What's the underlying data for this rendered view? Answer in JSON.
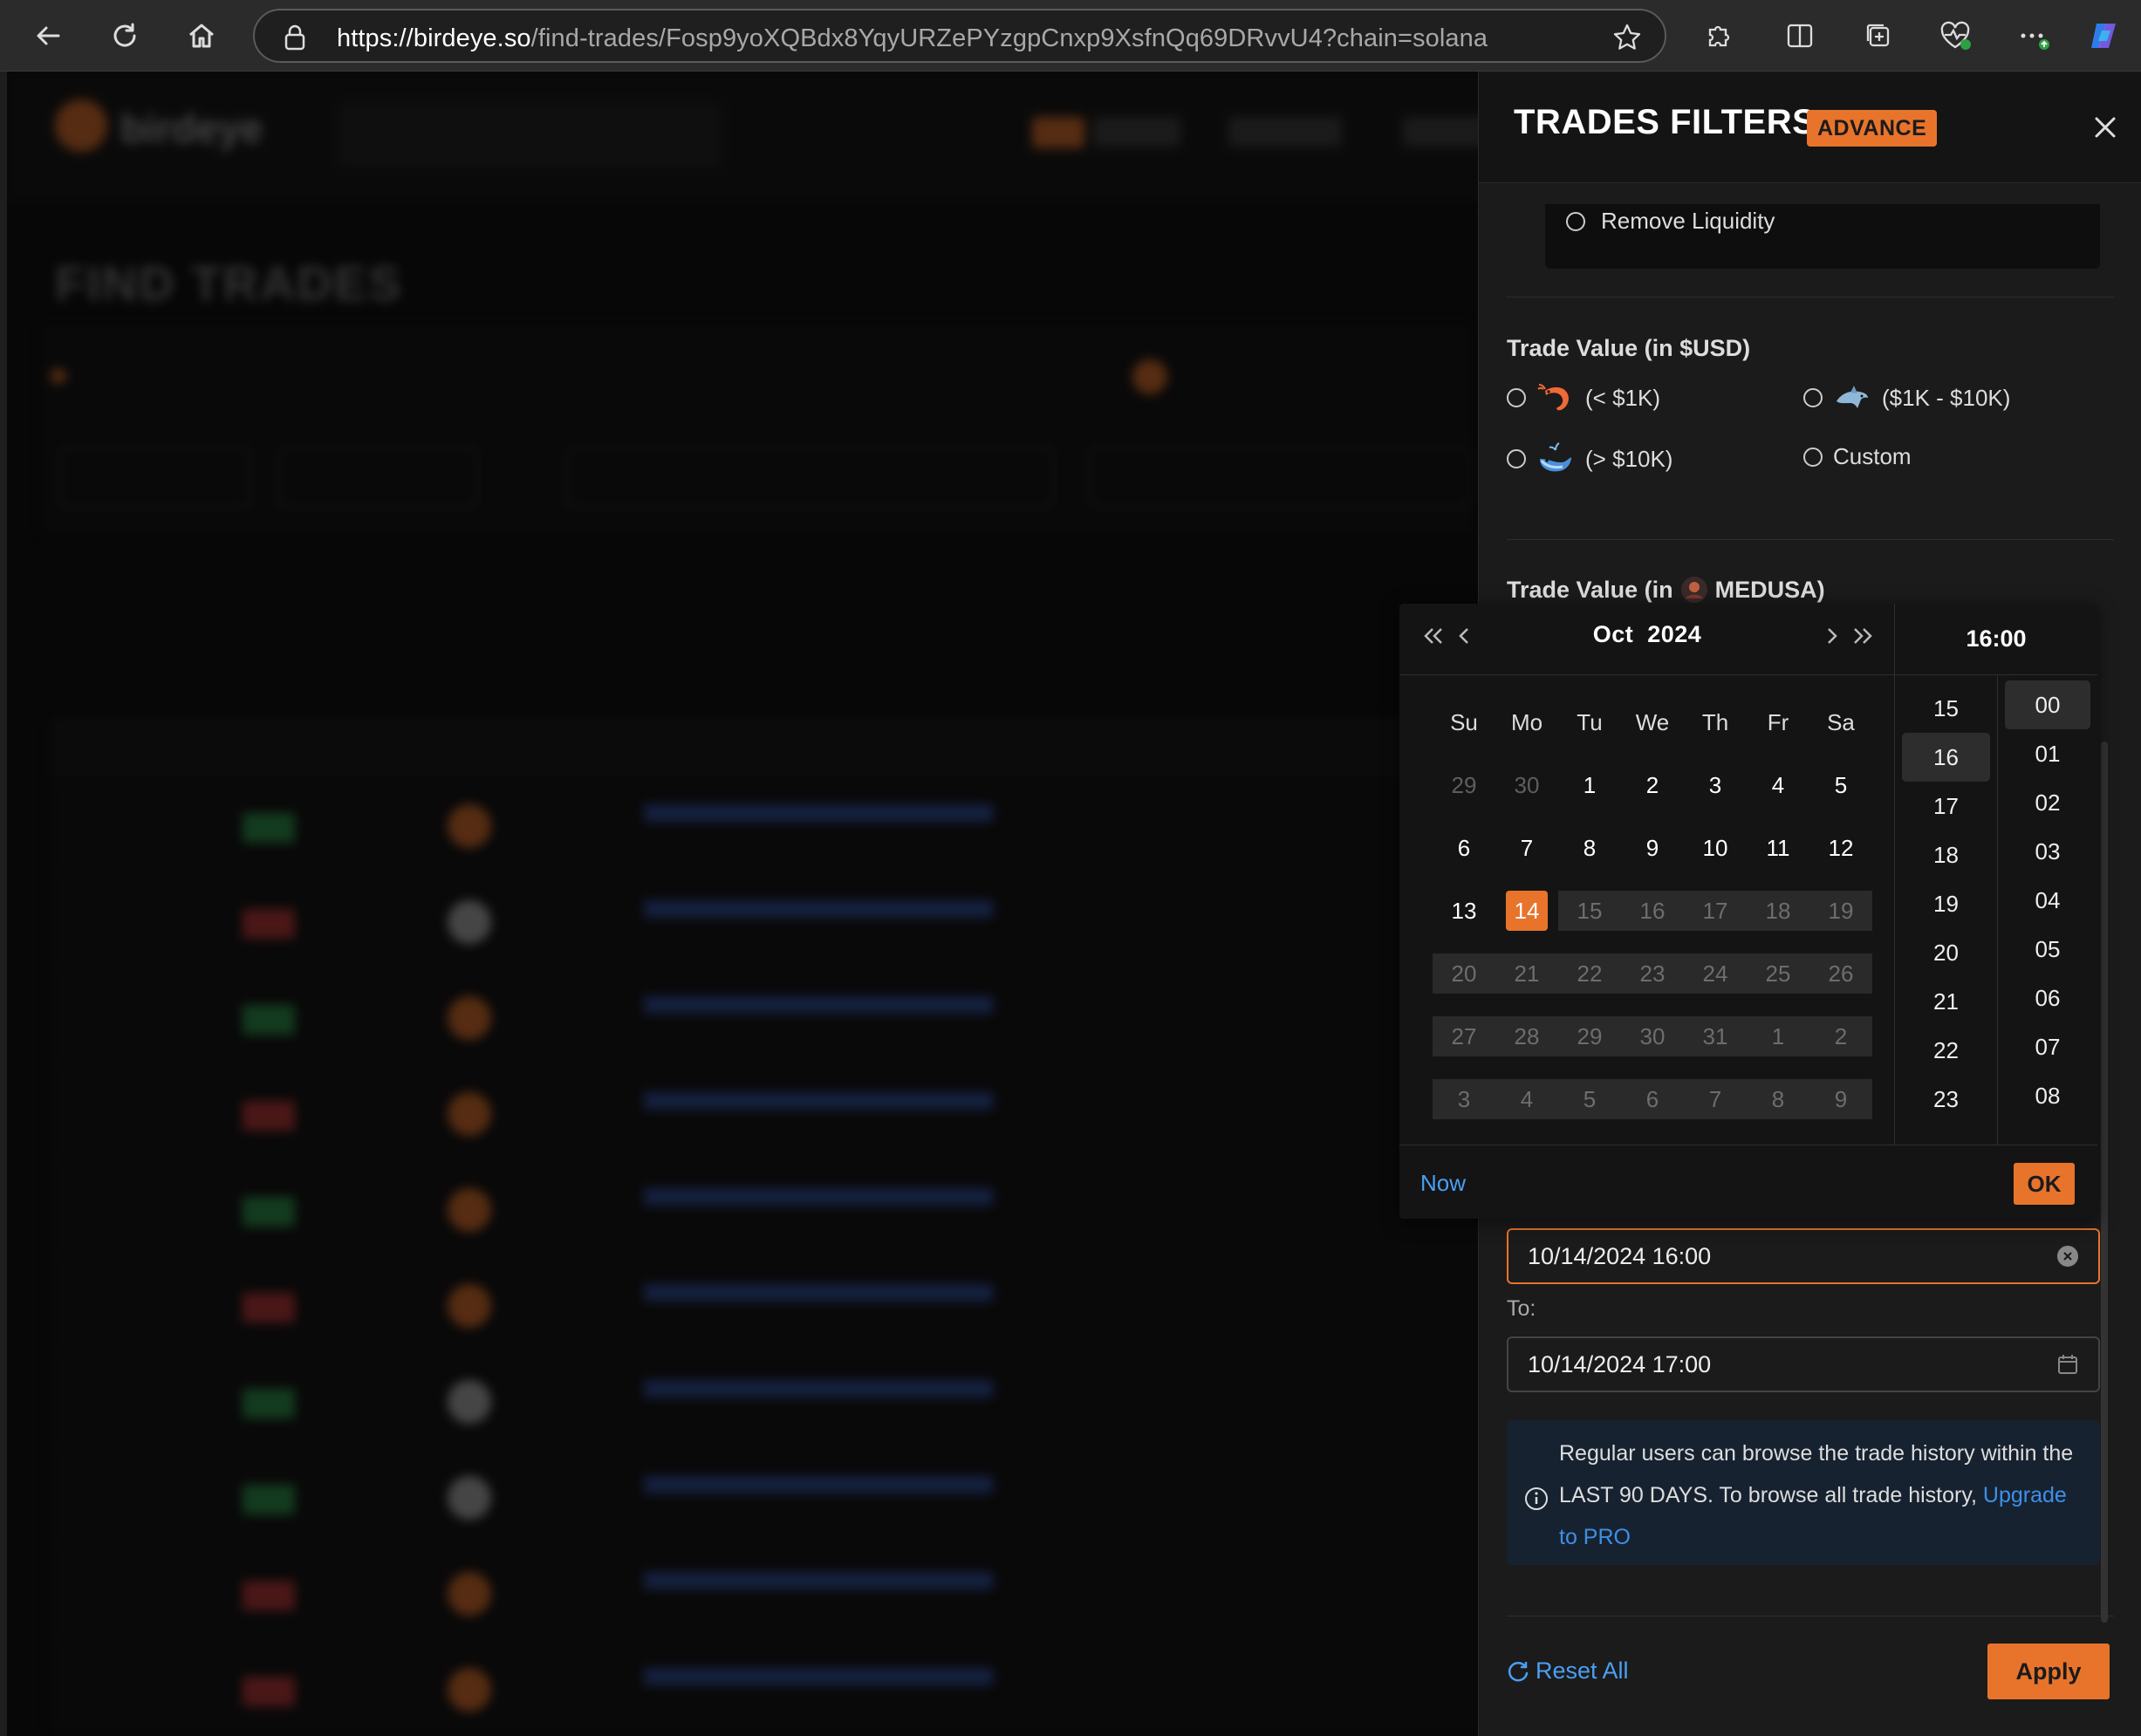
{
  "browser": {
    "url_host": "https://birdeye.so",
    "url_path": "/find-trades/Fosp9yoXQBdx8YqyURZePYzgpCnxp9XsfnQq69DRvvU4?chain=solana"
  },
  "background_page": {
    "logo_text": "birdeye",
    "page_title": "FIND TRADES"
  },
  "drawer": {
    "title": "TRADES FILTERS",
    "badge": "ADVANCE",
    "remove_liquidity_label": "Remove Liquidity",
    "trade_value_usd_title": "Trade Value (in $USD)",
    "trade_value_options": [
      {
        "label": "(< $1K)",
        "icon": "shrimp-icon"
      },
      {
        "label": "($1K - $10K)",
        "icon": "dolphin-icon"
      },
      {
        "label": "(> $10K)",
        "icon": "whale-icon"
      },
      {
        "label": "Custom",
        "icon": ""
      }
    ],
    "trade_value_token_prefix": "Trade Value (in",
    "trade_value_token_suffix": "MEDUSA)",
    "from_value": "10/14/2024 16:00",
    "to_label": "To:",
    "to_value": "10/14/2024 17:00",
    "info_part1": "Regular users can browse the trade history within the LAST 90 DAYS. To browse all trade history, ",
    "info_link": "Upgrade to PRO",
    "reset_label": "Reset All",
    "apply_label": "Apply"
  },
  "calendar": {
    "month": "Oct",
    "year": "2024",
    "time_header": "16:00",
    "weekdays": [
      "Su",
      "Mo",
      "Tu",
      "We",
      "Th",
      "Fr",
      "Sa"
    ],
    "weeks": [
      [
        "29",
        "30",
        "1",
        "2",
        "3",
        "4",
        "5"
      ],
      [
        "6",
        "7",
        "8",
        "9",
        "10",
        "11",
        "12"
      ],
      [
        "13",
        "14",
        "15",
        "16",
        "17",
        "18",
        "19"
      ],
      [
        "20",
        "21",
        "22",
        "23",
        "24",
        "25",
        "26"
      ],
      [
        "27",
        "28",
        "29",
        "30",
        "31",
        "1",
        "2"
      ],
      [
        "3",
        "4",
        "5",
        "6",
        "7",
        "8",
        "9"
      ]
    ],
    "selected_day": "14",
    "hours": [
      "15",
      "16",
      "17",
      "18",
      "19",
      "20",
      "21",
      "22",
      "23"
    ],
    "selected_hour": "16",
    "minutes": [
      "00",
      "01",
      "02",
      "03",
      "04",
      "05",
      "06",
      "07",
      "08"
    ],
    "selected_minute": "00",
    "now_label": "Now",
    "ok_label": "OK"
  },
  "colors": {
    "accent": "#e8742c",
    "link": "#4a9ff5",
    "panel_bg": "#1b1b1b"
  }
}
